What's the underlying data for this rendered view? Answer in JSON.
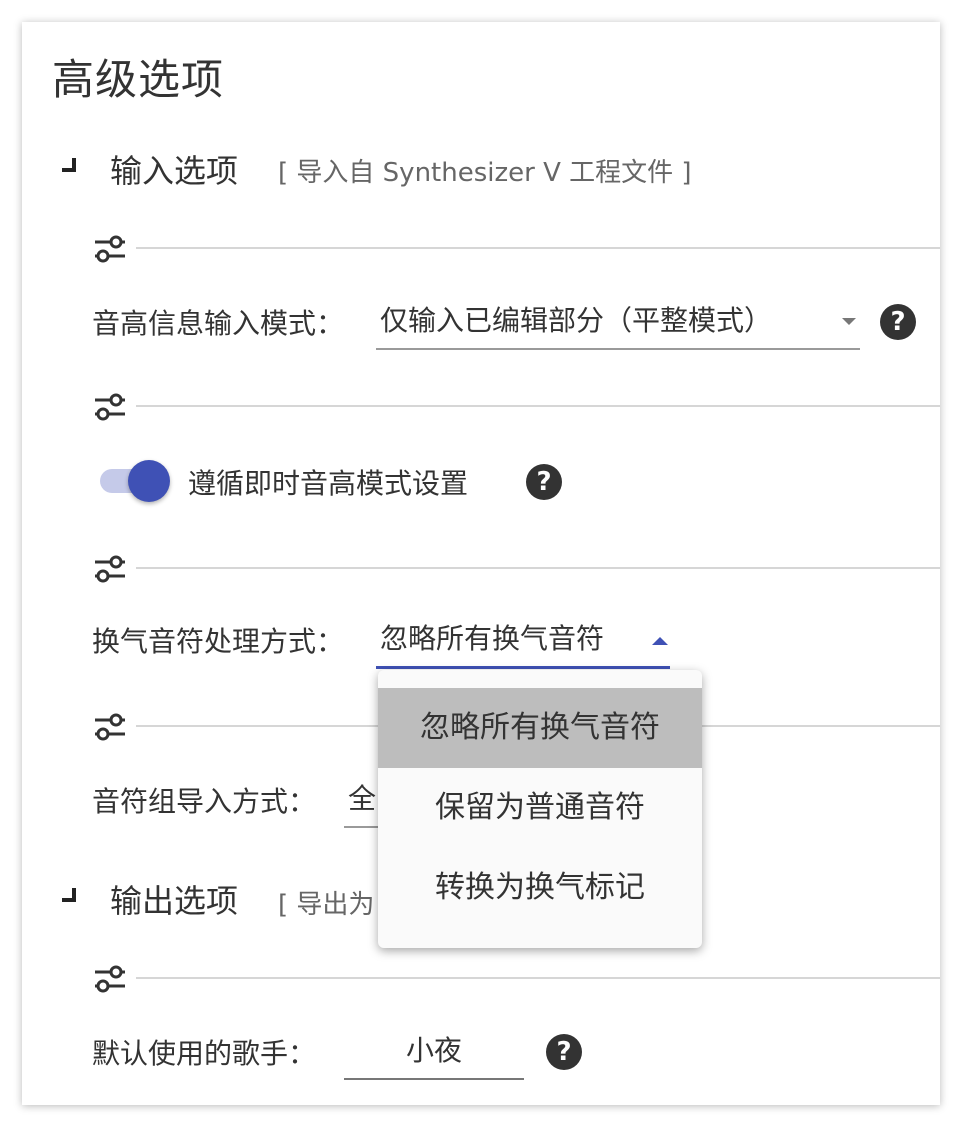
{
  "page_title": "高级选项",
  "input_section": {
    "title": "输入选项",
    "subtitle": "[ 导入自 Synthesizer V 工程文件 ]"
  },
  "pitch_input_mode": {
    "label": "音高信息输入模式：",
    "value": "仅输入已编辑部分（平整模式）"
  },
  "follow_instant_pitch": {
    "label": "遵循即时音高模式设置",
    "enabled": true
  },
  "breath_note_handling": {
    "label": "换气音符处理方式：",
    "value": "忽略所有换气音符",
    "options": [
      "忽略所有换气音符",
      "保留为普通音符",
      "转换为换气标记"
    ],
    "selected_index": 0
  },
  "note_group_import": {
    "label": "音符组导入方式：",
    "value": "全"
  },
  "output_section": {
    "title": "输出选项",
    "subtitle": "[ 导出为"
  },
  "default_singer": {
    "label": "默认使用的歌手：",
    "value": "小夜"
  },
  "help_glyph": "?",
  "colors": {
    "accent": "#3f51b5",
    "switch_track": "#c5cae9",
    "selected_option_bg": "#bdbdbd",
    "help_icon": "#333333"
  }
}
